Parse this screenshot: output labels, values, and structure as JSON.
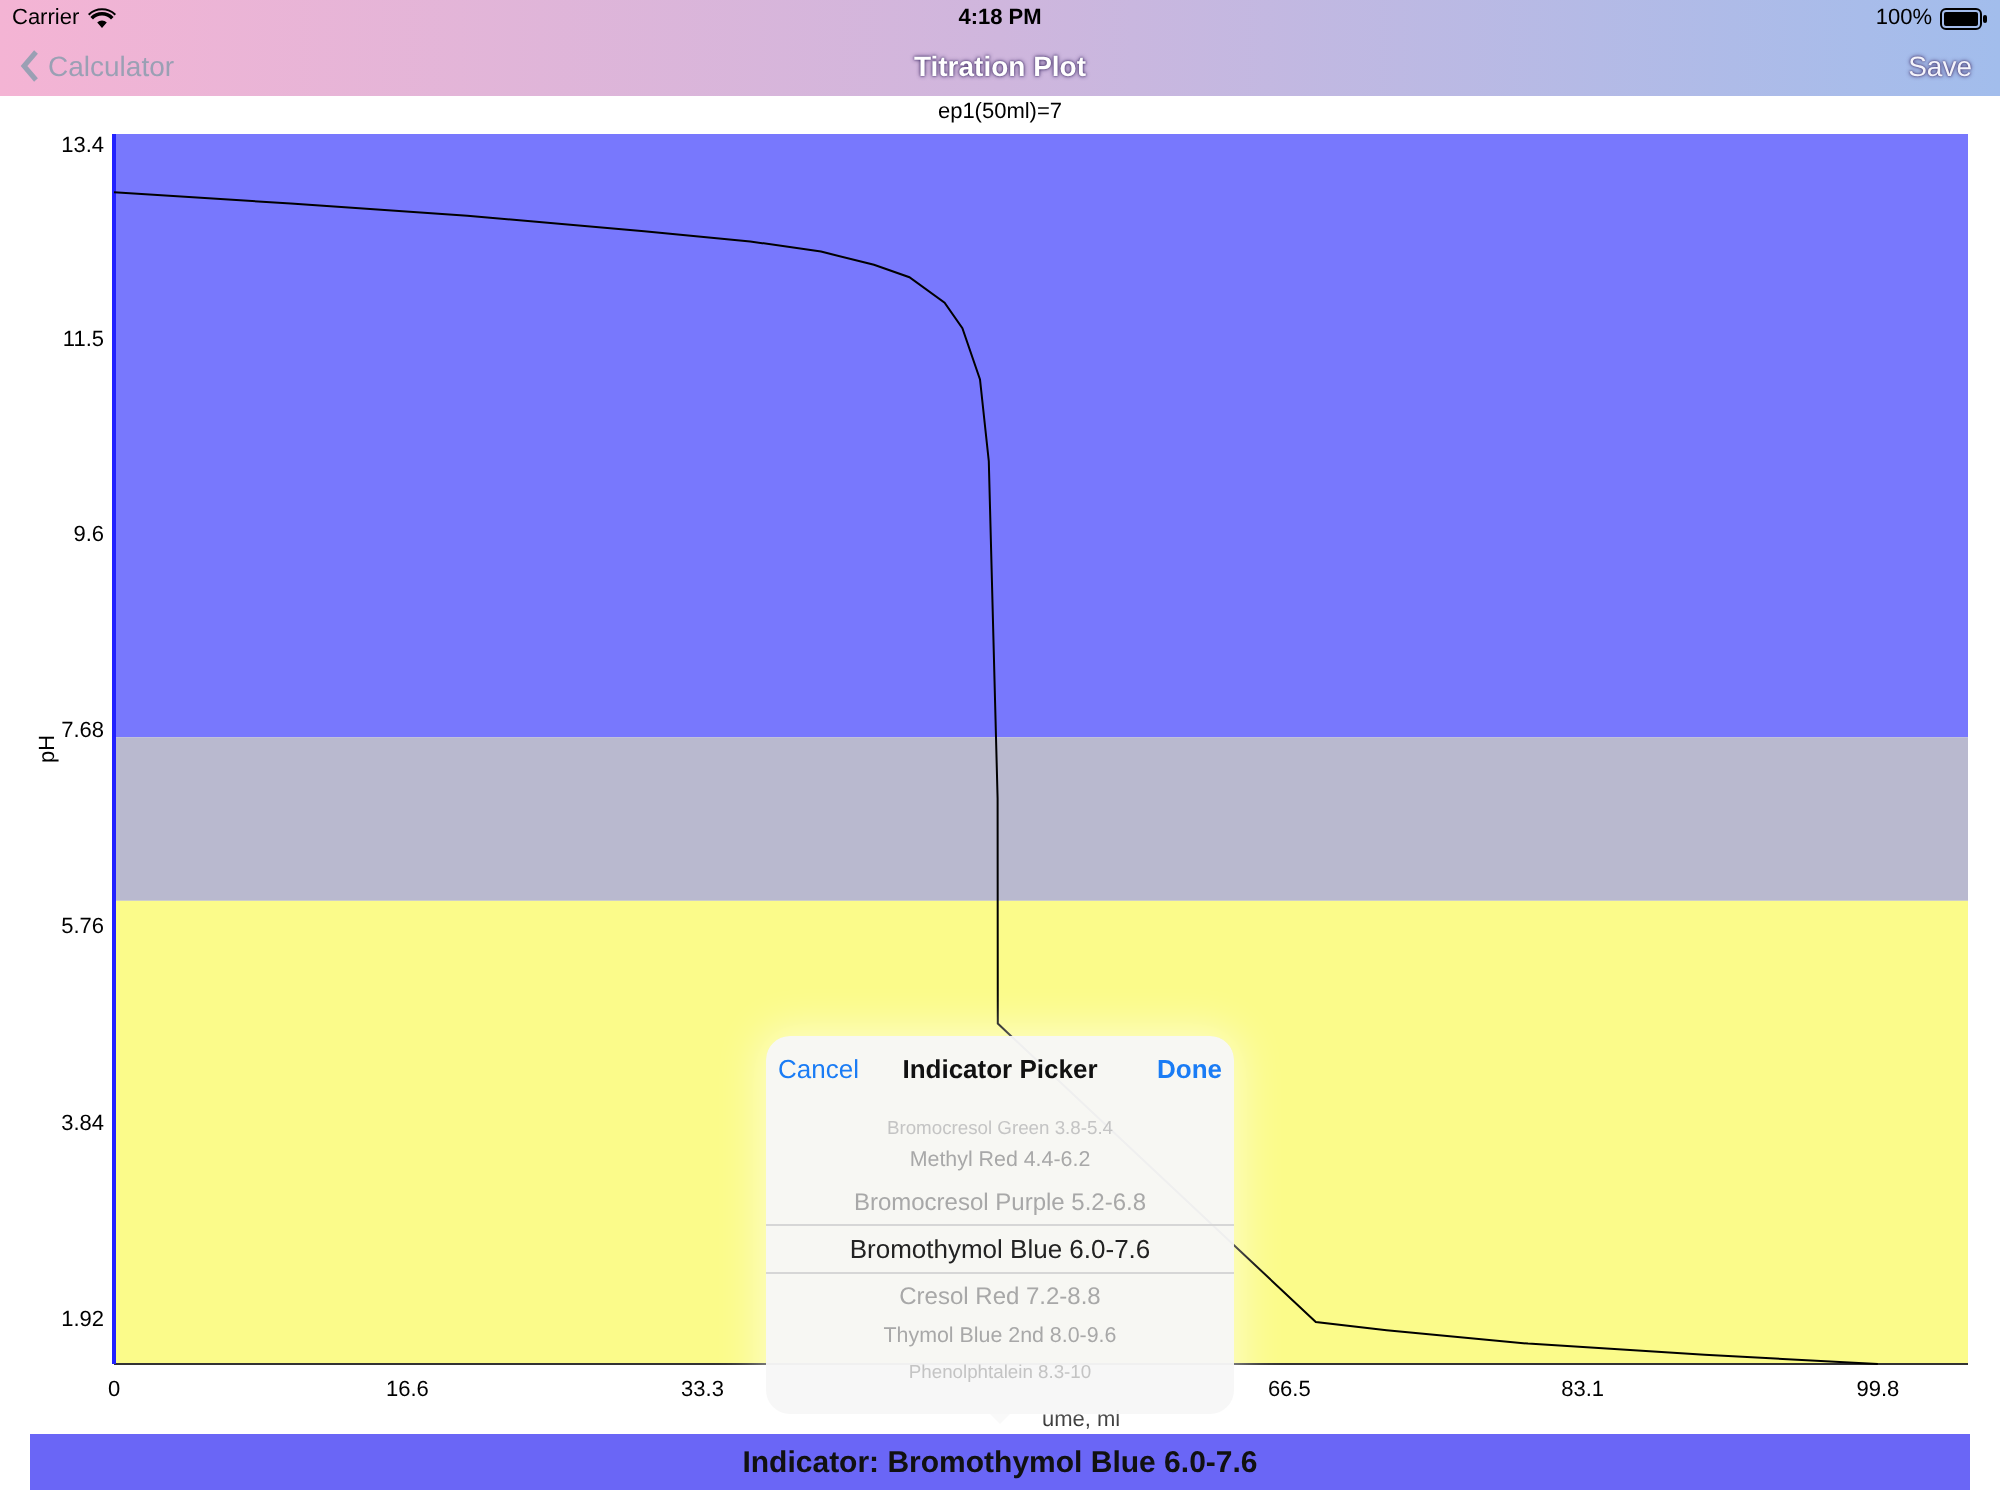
{
  "status_bar": {
    "carrier": "Carrier",
    "time": "4:18 PM",
    "battery": "100%"
  },
  "nav": {
    "back": "Calculator",
    "title": "Titration Plot",
    "save": {
      "label": "Save",
      "disabled": true
    }
  },
  "plot": {
    "chart_data": {
      "type": "line",
      "title": "ep1(50ml)=7",
      "xlabel": "ume, ml",
      "ylabel": "pH",
      "xlim": [
        0,
        104.9
      ],
      "ylim": [
        1.47,
        13.5
      ],
      "xticks": [
        0,
        16.6,
        33.3,
        66.5,
        83.1,
        99.8
      ],
      "yticks": [
        1.92,
        3.84,
        5.76,
        7.68,
        9.6,
        11.5,
        13.4
      ],
      "x": [
        0,
        10,
        20,
        30,
        36,
        40,
        43,
        45,
        47,
        48,
        49,
        49.5,
        50,
        50.01,
        68,
        72,
        80,
        90,
        99.8
      ],
      "series": [
        {
          "color": "#000000",
          "values": [
            12.93,
            12.82,
            12.7,
            12.55,
            12.45,
            12.35,
            12.22,
            12.1,
            11.85,
            11.6,
            11.1,
            10.3,
            7.0,
            4.8,
            1.88,
            1.8,
            1.67,
            1.56,
            1.47
          ]
        }
      ],
      "bands": [
        {
          "axis": "y",
          "from": 7.6,
          "to": 13.5,
          "color": "#7878fd"
        },
        {
          "axis": "y",
          "from": 6.0,
          "to": 7.6,
          "color": "#b9b9cf"
        },
        {
          "axis": "y",
          "from": 1.47,
          "to": 6.0,
          "color": "#fbfb8a"
        }
      ]
    }
  },
  "picker": {
    "title": "Indicator Picker",
    "cancel": "Cancel",
    "done": "Done",
    "items": [
      {
        "label": "Bromocresol Green 3.8-5.4",
        "selected": false
      },
      {
        "label": "Methyl Red 4.4-6.2",
        "selected": false
      },
      {
        "label": "Bromocresol Purple 5.2-6.8",
        "selected": false
      },
      {
        "label": "Bromothymol Blue 6.0-7.6",
        "selected": true
      },
      {
        "label": "Cresol Red 7.2-8.8",
        "selected": false
      },
      {
        "label": "Thymol Blue 2nd 8.0-9.6",
        "selected": false
      },
      {
        "label": "Phenolphtalein 8.3-10",
        "selected": false
      }
    ]
  },
  "indicator_bar": "Indicator: Bromothymol Blue 6.0-7.6"
}
